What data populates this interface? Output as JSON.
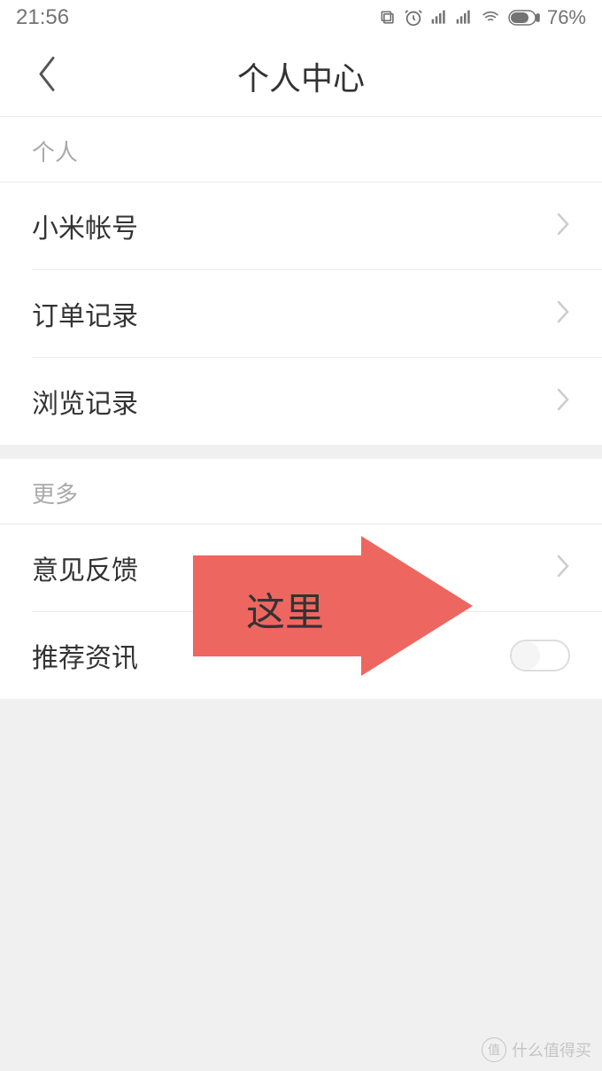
{
  "status_bar": {
    "time": "21:56",
    "battery_percent": "76%"
  },
  "header": {
    "title": "个人中心"
  },
  "sections": {
    "personal": {
      "header": "个人",
      "items": [
        {
          "label": "小米帐号"
        },
        {
          "label": "订单记录"
        },
        {
          "label": "浏览记录"
        }
      ]
    },
    "more": {
      "header": "更多",
      "items": [
        {
          "label": "意见反馈",
          "type": "chevron"
        },
        {
          "label": "推荐资讯",
          "type": "toggle",
          "toggle_on": false
        }
      ]
    }
  },
  "annotation": {
    "arrow_text": "这里",
    "arrow_color": "#ee6660"
  },
  "watermark": {
    "logo_text": "值",
    "text": "什么值得买"
  }
}
